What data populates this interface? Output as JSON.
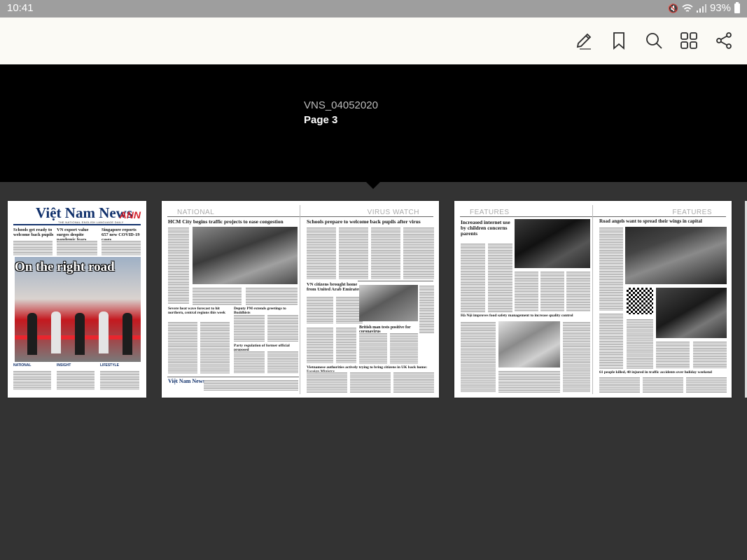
{
  "status_bar": {
    "time": "10:41",
    "battery": "93%"
  },
  "toolbar": {
    "icons": [
      "edit-icon",
      "bookmark-icon",
      "search-icon",
      "pages-grid-icon",
      "share-icon"
    ]
  },
  "header": {
    "issue_name": "VNS_04052020",
    "page_label": "Page 3"
  },
  "thumbnails": {
    "front": {
      "logo": "Việt Nam News",
      "ann": "ANN",
      "tagline": "THE NATIONAL ENGLISH LANGUAGE DAILY",
      "stories": [
        "Schools get ready to welcome back pupils",
        "VN export value surges despite pandemic fears",
        "Singapore reports 657 new COVID-19 cases"
      ],
      "headline": "On the right road",
      "footer": [
        "NATIONAL",
        "INSIGHT",
        "LIFESTYLE"
      ]
    },
    "spread1": {
      "left_section": "NATIONAL",
      "right_section": "VIRUS WATCH",
      "headlines": [
        "HCM City begins traffic projects to ease congestion",
        "Schools prepare to welcome back pupils after virus",
        "Severe heat wave forecast to hit northern, central regions this week",
        "Deputy PM extends greetings to Buddhists",
        "Party regulation of former official proposed",
        "VN citizens brought home from United Arab Emirates",
        "British man tests positive for coronavirus",
        "Vietnamese authorities actively trying to bring citizens in UK back home: Foreign Ministry"
      ],
      "logo": "Việt Nam News"
    },
    "spread2": {
      "left_section": "FEATURES",
      "right_section": "FEATURES",
      "headlines": [
        "Increased internet use by children concerns parents",
        "Road angels want to spread their wings in capital",
        "Hà Nội improves food safety management to increase quality control",
        "61 people killed, 40 injured in traffic accidents over holiday weekend"
      ]
    }
  },
  "colors": {
    "status_bar": "#9e9e9e",
    "toolbar": "#fbfaf5",
    "header": "#000000",
    "background": "#333333",
    "brand_blue": "#10306b",
    "brand_red": "#d3202b"
  }
}
